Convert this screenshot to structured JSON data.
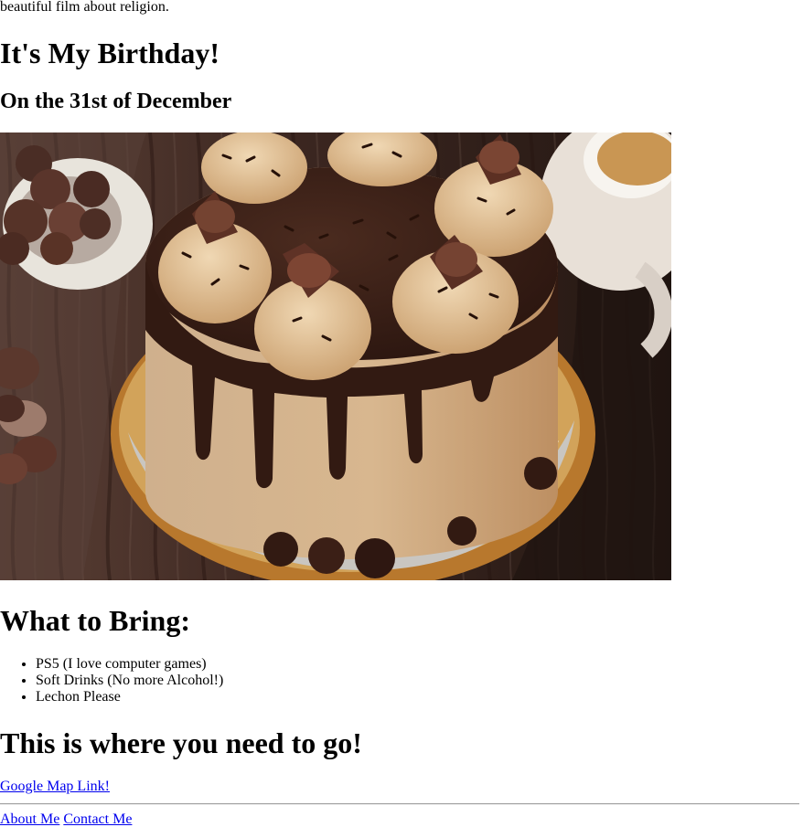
{
  "intro_text": "beautiful film about religion.",
  "heading": "It's My Birthday!",
  "date": "On the 31st of December",
  "colors": {
    "background": "#ffffff",
    "text": "#000000",
    "link": "#0000ee",
    "cake_chocolate": "#3b1f14",
    "cake_frosting": "#c89c6a",
    "wood_table": "#3f2a22"
  },
  "image": {
    "alt": "Chocolate drip cake with peanut butter frosting, cups and sprinkles",
    "icon": "photo-icon"
  },
  "bring": {
    "title": "What to Bring:",
    "items": [
      "PS5 (I love computer games)",
      "Soft Drinks (No more Alcohol!)",
      "Lechon Please"
    ]
  },
  "location": {
    "title": "This is where you need to go!",
    "link_label": "Google Map Link!"
  },
  "footer": {
    "about_label": "About Me",
    "contact_label": "Contact Me"
  }
}
